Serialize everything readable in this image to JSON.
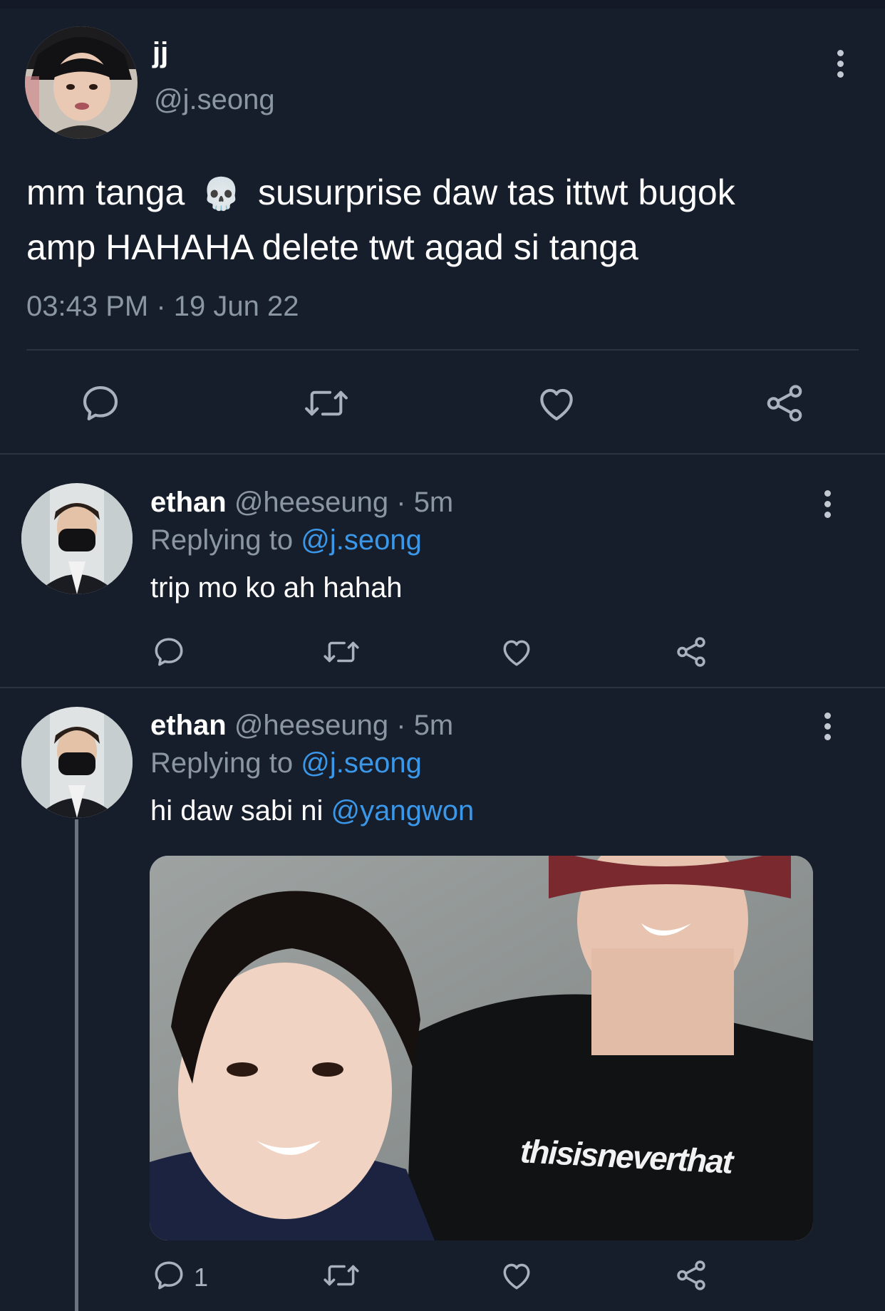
{
  "main_tweet": {
    "display_name": "jj",
    "handle": "@j.seong",
    "text_part1": "mm tanga",
    "emoji": "💀",
    "text_part2": "susurprise daw tas ittwt bugok",
    "text_line2": "amp HAHAHA delete twt agad si tanga",
    "timestamp": "03:43 PM · 19 Jun 22"
  },
  "replies": [
    {
      "display_name": "ethan",
      "handle_time": "@heeseung · 5m",
      "replying_prefix": "Replying to",
      "replying_handle": "@j.seong",
      "text": "trip mo ko ah hahah",
      "reply_count": ""
    },
    {
      "display_name": "ethan",
      "handle_time": "@heeseung · 5m",
      "replying_prefix": "Replying to",
      "replying_handle": "@j.seong",
      "text": "hi daw sabi ni",
      "mention": "@yangwon",
      "image_text": "thisisneverthat",
      "reply_count": "1"
    }
  ],
  "colors": {
    "background": "#161d2b",
    "link": "#3b97e8",
    "muted": "#8b96a5",
    "icon": "#a8b1bd",
    "divider": "#2a3343"
  },
  "icons": [
    "more-vertical-icon",
    "reply-icon",
    "retweet-icon",
    "like-icon",
    "share-icon"
  ]
}
